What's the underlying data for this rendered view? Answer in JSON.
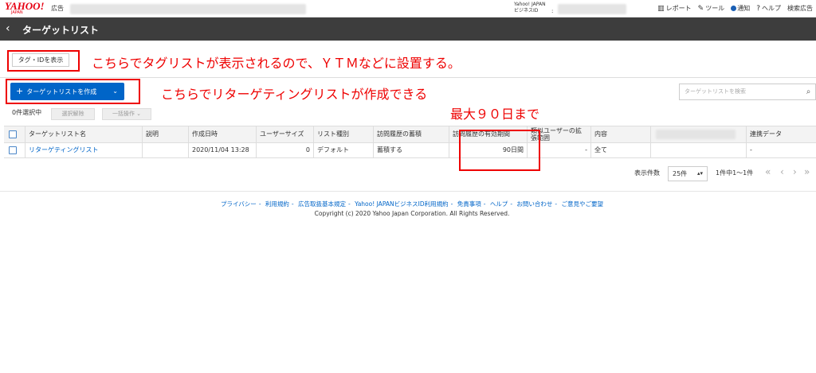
{
  "header": {
    "logo": "YAHOO!",
    "logo_sub": "JAPAN",
    "logo_ext": "広告",
    "bizid_line1": "Yahoo! JAPAN",
    "bizid_line2": "ビジネスID",
    "bizid_colon": ":",
    "nav": {
      "report": "レポート",
      "tools": "ツール",
      "notice": "通知",
      "help": "ヘルプ",
      "search_ads": "検索広告"
    }
  },
  "titlebar": {
    "back": "‹",
    "title": "ターゲットリスト"
  },
  "actions": {
    "show_tag": "タグ・IDを表示",
    "create": "ターゲットリストを作成",
    "search_placeholder": "ターゲットリストを検索",
    "selected": "0件選択中",
    "deselect": "選択解除",
    "bulk": "一括操作"
  },
  "annotations": {
    "tag_note": "こちらでタグリストが表示されるので、ＹＴＭなどに設置する。",
    "create_note": "こちらでリターゲティングリストが作成できる",
    "max_note": "最大９０日まで"
  },
  "table": {
    "headers": [
      "ターゲットリスト名",
      "説明",
      "作成日時",
      "ユーザーサイズ",
      "リスト種別",
      "訪問履歴の蓄積",
      "訪問履歴の有効期間",
      "類似ユーザーの拡張範囲",
      "内容",
      "",
      "連携データ"
    ],
    "rows": [
      {
        "name": "リターゲティングリスト",
        "description": "",
        "created": "2020/11/04 13:28",
        "size": "0",
        "type": "デフォルト",
        "accumulate": "蓄積する",
        "period": "90日間",
        "similar": "-",
        "content": "全て",
        "blank": "",
        "linked": "-"
      }
    ]
  },
  "pagination": {
    "label": "表示件数",
    "count": "25件",
    "range": "1件中1～1件"
  },
  "footer": {
    "links": [
      "プライバシー",
      "利用規約",
      "広告取扱基本規定",
      "Yahoo! JAPANビジネスID利用規約",
      "免責事項",
      "ヘルプ",
      "お問い合わせ",
      "ご意見やご要望"
    ],
    "copyright": "Copyright (c) 2020 Yahoo Japan Corporation. All Rights Reserved."
  },
  "colors": {
    "brand_red": "#e60012",
    "primary_blue": "#0065c8",
    "annotation_red": "#ee0000",
    "titlebar": "#3d3d3d"
  }
}
